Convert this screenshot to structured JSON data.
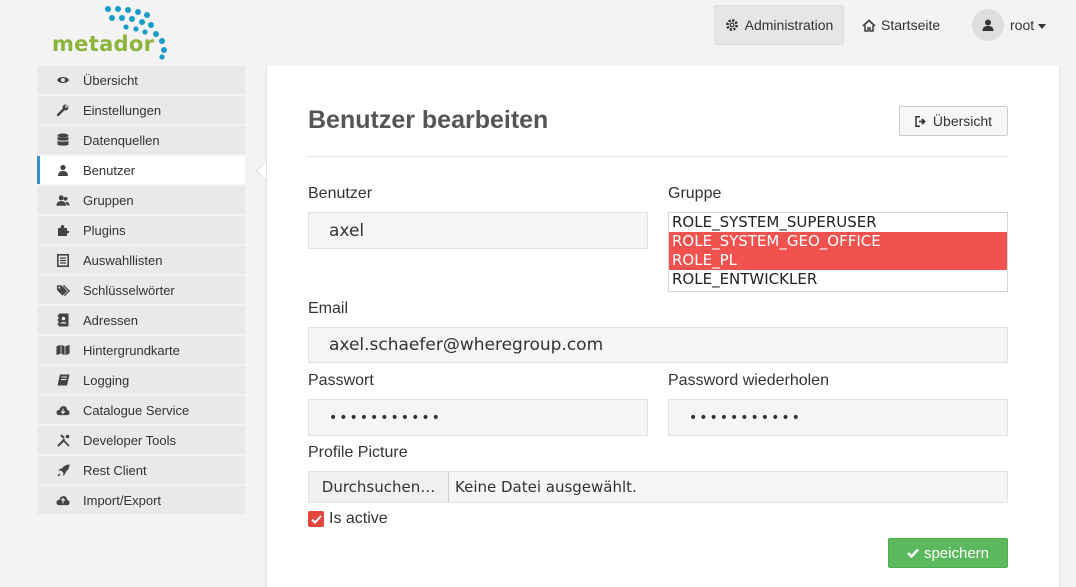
{
  "brand": {
    "name": "metador",
    "dot_color": "#1a9cc9",
    "text_color": "#8cb43c"
  },
  "header": {
    "admin_label": "Administration",
    "start_label": "Startseite",
    "user_label": "root"
  },
  "sidebar": {
    "items": [
      {
        "label": "Übersicht",
        "icon": "eye-icon"
      },
      {
        "label": "Einstellungen",
        "icon": "wrench-icon"
      },
      {
        "label": "Datenquellen",
        "icon": "database-icon"
      },
      {
        "label": "Benutzer",
        "icon": "user-icon",
        "active": true
      },
      {
        "label": "Gruppen",
        "icon": "users-icon"
      },
      {
        "label": "Plugins",
        "icon": "puzzle-icon"
      },
      {
        "label": "Auswahllisten",
        "icon": "list-icon"
      },
      {
        "label": "Schlüsselwörter",
        "icon": "tags-icon"
      },
      {
        "label": "Adressen",
        "icon": "address-book-icon"
      },
      {
        "label": "Hintergrundkarte",
        "icon": "map-icon"
      },
      {
        "label": "Logging",
        "icon": "book-icon"
      },
      {
        "label": "Catalogue Service",
        "icon": "cloud-icon"
      },
      {
        "label": "Developer Tools",
        "icon": "tools-icon"
      },
      {
        "label": "Rest Client",
        "icon": "rocket-icon"
      },
      {
        "label": "Import/Export",
        "icon": "cloud-upload-icon"
      }
    ]
  },
  "main": {
    "title": "Benutzer bearbeiten",
    "overview_button": "Übersicht",
    "user_label": "Benutzer",
    "user_value": "axel",
    "group_label": "Gruppe",
    "groups": [
      {
        "label": "ROLE_SYSTEM_SUPERUSER",
        "selected": false
      },
      {
        "label": "ROLE_SYSTEM_GEO_OFFICE",
        "selected": true
      },
      {
        "label": "ROLE_PL",
        "selected": true
      },
      {
        "label": "ROLE_ENTWICKLER",
        "selected": false
      }
    ],
    "email_label": "Email",
    "email_value": "axel.schaefer@wheregroup.com",
    "password_label": "Passwort",
    "password_value": "•••••••••••",
    "password_repeat_label": "Password wiederholen",
    "password_repeat_value": "•••••••••••",
    "picture_label": "Profile Picture",
    "file_button": "Durchsuchen…",
    "file_status": "Keine Datei ausgewählt.",
    "active_label": "Is active",
    "active_checked": true,
    "save_button": "speichern"
  },
  "colors": {
    "accent": "#3a8fbf",
    "selected": "#f0524f",
    "save": "#5cb85c"
  }
}
